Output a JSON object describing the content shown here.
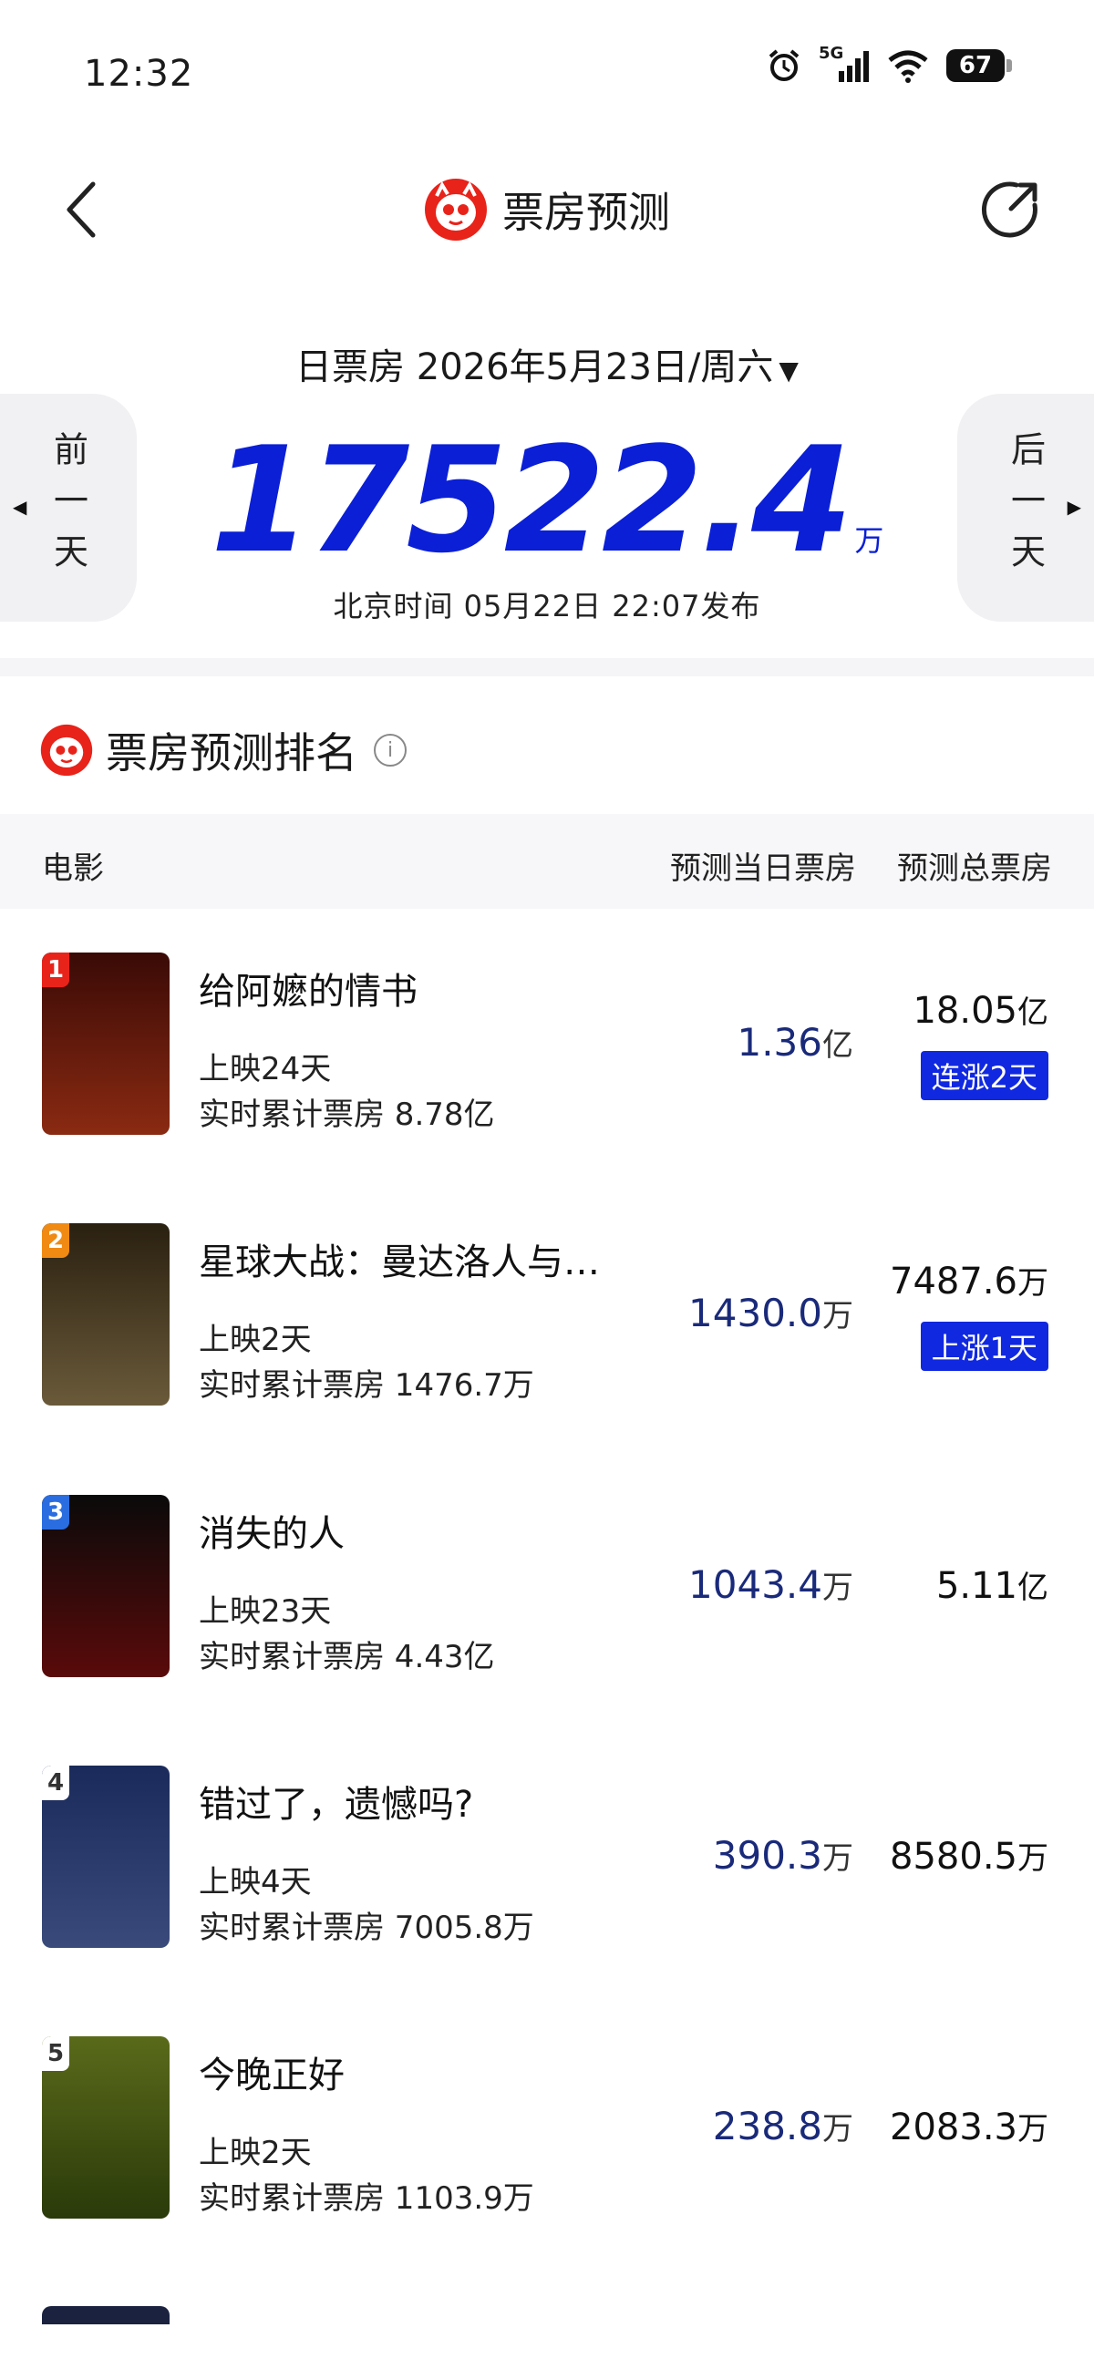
{
  "status_bar": {
    "time": "12:32",
    "network": "5G",
    "battery": "67"
  },
  "nav": {
    "title": "票房预测"
  },
  "summary": {
    "date_label": "日票房 2026年5月23日/周六",
    "total_value": "17522.4",
    "total_unit": "万",
    "publish_time": "北京时间  05月22日  22:07发布",
    "prev_day": "前一天",
    "next_day": "后一天"
  },
  "ranking": {
    "title": "票房预测排名",
    "columns": {
      "movie": "电影",
      "day": "预测当日票房",
      "total": "预测总票房"
    },
    "rows": [
      {
        "rank": "1",
        "name": "给阿嬷的情书",
        "days": "上映24天",
        "cumulative": "实时累计票房 8.78亿",
        "day_value": "1.36",
        "day_unit": "亿",
        "total_value": "18.05",
        "total_unit": "亿",
        "trend": "连涨2天",
        "badge_color": "#e8231a",
        "poster_colors": [
          "#3a0a06",
          "#8a2a12"
        ]
      },
      {
        "rank": "2",
        "name": "星球大战：曼达洛人与…",
        "days": "上映2天",
        "cumulative": "实时累计票房 1476.7万",
        "day_value": "1430.0",
        "day_unit": "万",
        "total_value": "7487.6",
        "total_unit": "万",
        "trend": "上涨1天",
        "badge_color": "#f08a12",
        "poster_colors": [
          "#2a2010",
          "#6a5a3a"
        ]
      },
      {
        "rank": "3",
        "name": "消失的人",
        "days": "上映23天",
        "cumulative": "实时累计票房 4.43亿",
        "day_value": "1043.4",
        "day_unit": "万",
        "total_value": "5.11",
        "total_unit": "亿",
        "trend": "",
        "badge_color": "#2a6de0",
        "poster_colors": [
          "#0a0a0a",
          "#5a0a0a"
        ]
      },
      {
        "rank": "4",
        "name": "错过了，遗憾吗?",
        "days": "上映4天",
        "cumulative": "实时累计票房 7005.8万",
        "day_value": "390.3",
        "day_unit": "万",
        "total_value": "8580.5",
        "total_unit": "万",
        "trend": "",
        "badge_color": "#ffffff",
        "poster_colors": [
          "#1a2a5a",
          "#3a4a7a"
        ]
      },
      {
        "rank": "5",
        "name": "今晚正好",
        "days": "上映2天",
        "cumulative": "实时累计票房 1103.9万",
        "day_value": "238.8",
        "day_unit": "万",
        "total_value": "2083.3",
        "total_unit": "万",
        "trend": "",
        "badge_color": "#ffffff",
        "poster_colors": [
          "#5a6a1a",
          "#2a3a0a"
        ]
      }
    ]
  },
  "colors": {
    "accent_blue": "#0a1fd6",
    "trend_bg": "#1028e0",
    "brand_red": "#e8231a"
  }
}
